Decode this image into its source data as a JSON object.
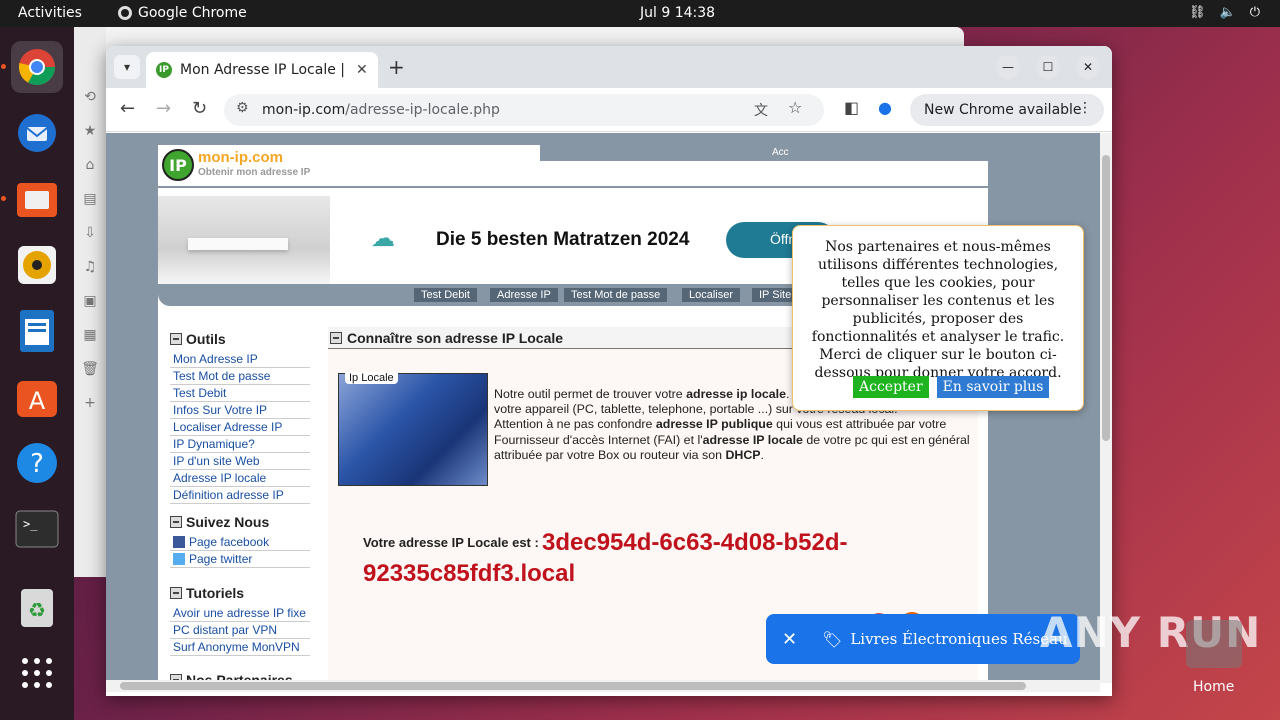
{
  "topbar": {
    "activities": "Activities",
    "app_name": "Google Chrome",
    "clock": "Jul 9  14:38"
  },
  "browser": {
    "tab_title": "Mon Adresse IP Locale | Q",
    "url_domain": "mon-ip.com",
    "url_path": "/adresse-ip-locale.php",
    "new_chrome": "New Chrome available"
  },
  "site": {
    "logo_name": "mon-ip.com",
    "logo_sub": "Obtenir mon adresse IP",
    "header_right": "Acc",
    "ad": {
      "title": "Die 5 besten Matratzen 2024",
      "button": "Öffn"
    },
    "menu": [
      "Test Debit",
      "Adresse IP",
      "Test Mot de passe",
      "Localiser",
      "IP Site"
    ],
    "sidebar": {
      "outils_title": "Outils",
      "outils": [
        "Mon Adresse IP",
        "Test Mot de passe",
        "Test Debit",
        "Infos Sur Votre IP",
        "Localiser Adresse IP",
        "IP Dynamique?",
        "IP d'un site Web",
        "Adresse IP locale",
        "Définition adresse IP"
      ],
      "suivez_title": "Suivez Nous",
      "suivez": [
        "Page facebook",
        "Page twitter"
      ],
      "tutoriels_title": "Tutoriels",
      "tutoriels": [
        "Avoir une adresse IP fixe",
        "PC distant par VPN",
        "Surf Anonyme MonVPN"
      ],
      "partenaires_title": "Nos Partenaires"
    },
    "main_title": "Connaître son adresse IP Locale",
    "image_label": "Ip Locale",
    "intro_p1_a": "Notre outil permet de trouver votre ",
    "intro_p1_b": "adresse ip locale",
    "intro_p1_c": ". C'est ce qui permet d'identifier votre appareil (PC, tablette, telephone, portable ...) sur votre réseau local.",
    "intro_p2_a": "Attention à ne pas confondre ",
    "intro_p2_b": "adresse IP publique",
    "intro_p2_c": " qui vous est attribuée par votre Fournisseur d'accès Internet (FAI) et l'",
    "intro_p2_d": "adresse IP locale",
    "intro_p2_e": " de votre pc qui est en général attribuée par votre Box ou routeur via son ",
    "intro_p2_f": "DHCP",
    "intro_p2_g": ".",
    "result_label": "Votre adresse IP Locale est :",
    "result_value": "3dec954d-6c63-4d08-b52d-92335c85fdf3.local"
  },
  "cookie": {
    "text": "Nos partenaires et nous-mêmes utilisons différentes technologies, telles que les cookies, pour personnaliser les contenus et les publicités, proposer des fonctionnalités et analyser le trafic. Merci de cliquer sur le bouton ci-dessous pour donner votre accord.",
    "accept": "Accepter",
    "more": "En savoir plus"
  },
  "toast": {
    "text": "Livres Électroniques Réseau Do..."
  },
  "watermark": "ANY RUN",
  "home_label": "Home",
  "colors": {
    "accept_btn": "#1fb41f",
    "more_btn": "#2f7bd3",
    "ip_red": "#c0121c",
    "toast_blue": "#1a73e8"
  }
}
